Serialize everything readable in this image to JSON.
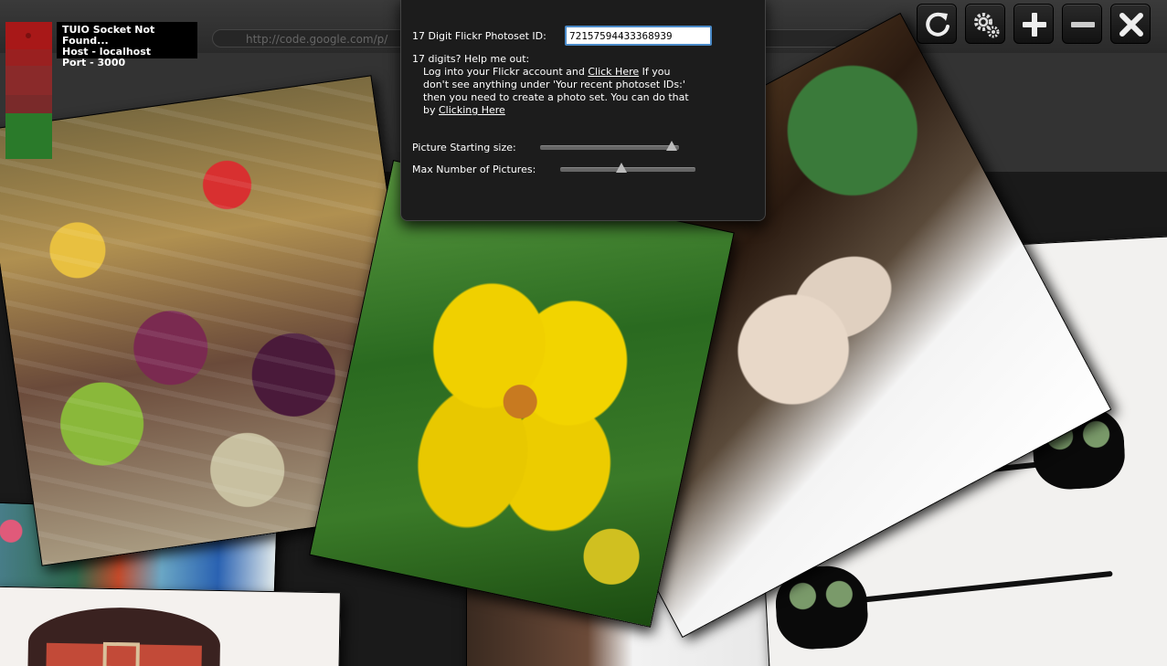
{
  "browser": {
    "url_text": "http://code.google.com/p/"
  },
  "status": {
    "line1": "TUIO Socket Not Found...",
    "line2": "Host - localhost",
    "line3": "Port - 3000"
  },
  "settings": {
    "photoset_label": "17 Digit Flickr Photoset ID:",
    "photoset_value": "72157594433368939",
    "help_heading": "17 digits?  Help me out:",
    "help_part1": "Log into your Flickr account and ",
    "help_link1": "Click Here",
    "help_part2": "   If you don't see anything under 'Your recent photoset IDs:' then you need to create a photo set.  You can do that by ",
    "help_link2": "Clicking Here",
    "start_size_label": "Picture Starting size:",
    "start_size_level": 0.95,
    "max_pictures_label": "Max Number of Pictures:",
    "max_pictures_level": 0.45
  },
  "toolbar": {
    "refresh_icon": "refresh-icon",
    "settings_icon": "gear-icon",
    "zoom_in_icon": "plus-icon",
    "zoom_out_icon": "minus-icon",
    "close_icon": "close-icon"
  },
  "colors": {
    "indicator_red": "#a81818",
    "indicator_green": "#2a7a2a",
    "input_focus": "#4a8ac8",
    "panel_bg": "#1c1c1c"
  }
}
